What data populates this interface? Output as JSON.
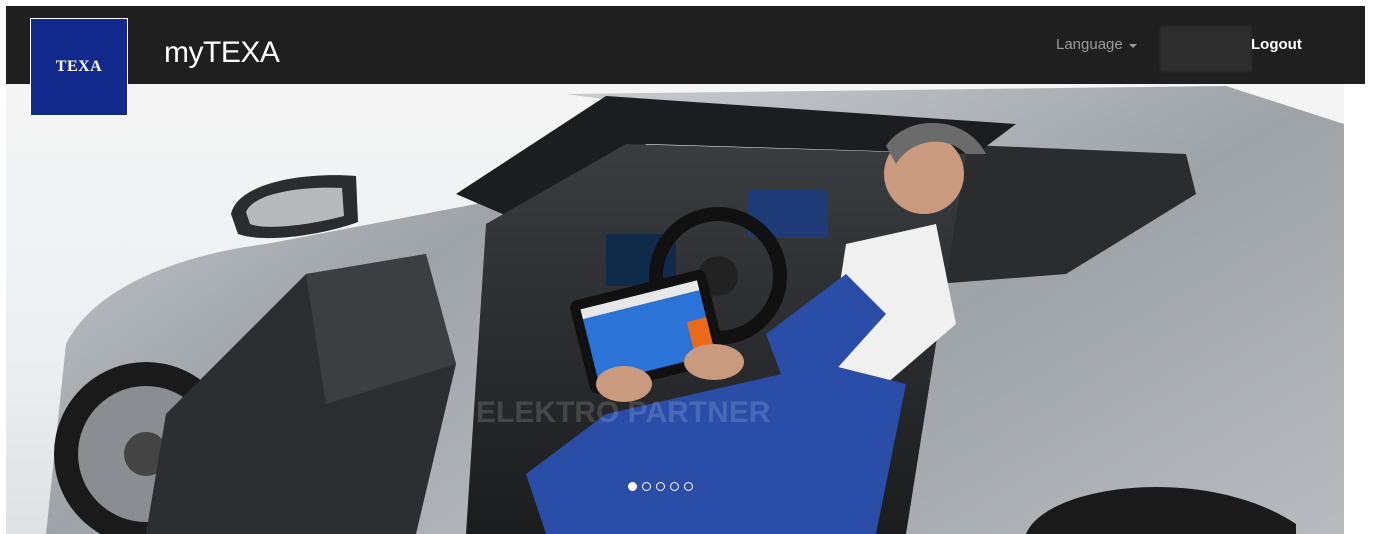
{
  "brand": {
    "logo_text": "TEXA",
    "app_title": "myTEXA",
    "logo_color": "#10298a"
  },
  "header": {
    "language_label": "Language",
    "logout_label": "Logout",
    "background": "#1f1f1f"
  },
  "carousel": {
    "slide_count": 5,
    "active_index": 0,
    "watermark": "ELEKTRO PARTNER",
    "icons": [
      "car-image",
      "technician-image",
      "tablet-icon"
    ]
  }
}
